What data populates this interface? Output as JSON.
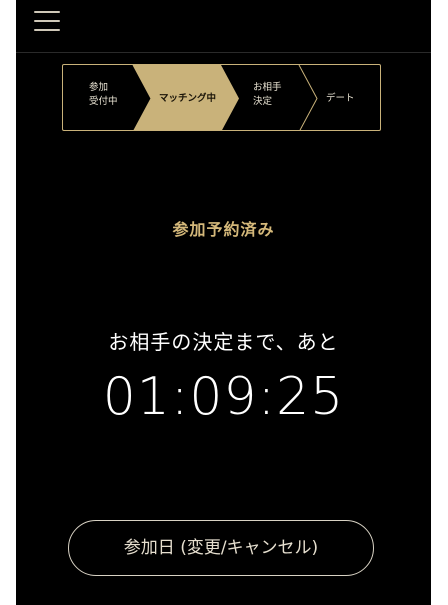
{
  "header": {
    "menu_icon": "hamburger-menu-icon"
  },
  "stepper": {
    "steps": [
      {
        "label": "参加\n受付中",
        "active": false
      },
      {
        "label": "マッチング中",
        "active": true
      },
      {
        "label": "お相手\n決定",
        "active": false
      },
      {
        "label": "デート",
        "active": false
      }
    ],
    "accent_color": "#c9b27a"
  },
  "status": {
    "text": "参加予約済み"
  },
  "countdown": {
    "label": "お相手の決定まで、あと",
    "time": "01:09:25"
  },
  "actions": {
    "date_button_label": "参加日 (変更/キャンセル)"
  },
  "colors": {
    "background": "#000000",
    "gold": "#d4b87a"
  }
}
